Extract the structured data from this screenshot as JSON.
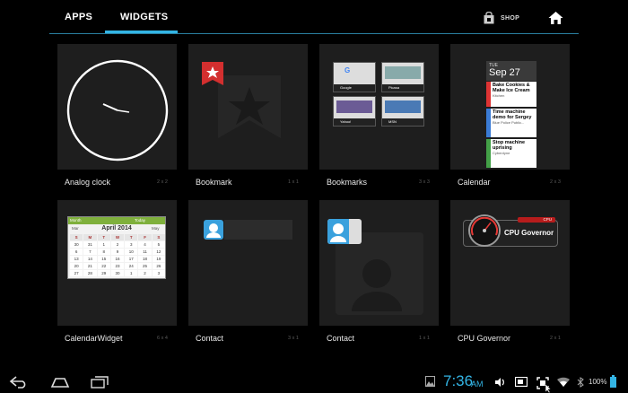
{
  "tabs": [
    {
      "label": "APPS"
    },
    {
      "label": "WIDGETS",
      "selected": true
    }
  ],
  "shop": {
    "label": "SHOP",
    "icon": "shopping-bag-icon"
  },
  "home": {
    "icon": "home-icon"
  },
  "widgets": [
    {
      "name": "Analog clock",
      "size": "2 x 2"
    },
    {
      "name": "Bookmark",
      "size": "1 x 1"
    },
    {
      "name": "Bookmarks",
      "size": "3 x 3"
    },
    {
      "name": "Calendar",
      "size": "2 x 3"
    },
    {
      "name": "CalendarWidget",
      "size": "6 x 4"
    },
    {
      "name": "Contact",
      "size": "3 x 1"
    },
    {
      "name": "Contact",
      "size": "1 x 1"
    },
    {
      "name": "CPU Governor",
      "size": "2 x 1"
    }
  ],
  "bookmarks_preview": [
    {
      "label": "Google"
    },
    {
      "label": "Picasa"
    },
    {
      "label": "Yahoo!"
    },
    {
      "label": "MSN"
    }
  ],
  "calendar_preview": {
    "day": "TUE",
    "date": "Sep 27",
    "events": [
      {
        "title": "Bake Cookies & Make Ice Cream",
        "sub": "Kitchen"
      },
      {
        "title": "Time machine demo for Sergey",
        "sub": "Blue Police Public..."
      },
      {
        "title": "Stop machine uprising",
        "sub": "Cyberdyne"
      }
    ]
  },
  "calendar_widget_preview": {
    "month_label": "Month",
    "today_label": "Today",
    "prev": "Mar",
    "title": "April 2014",
    "next": "May",
    "weekdays": [
      "S",
      "M",
      "T",
      "W",
      "T",
      "F",
      "S"
    ],
    "days": [
      "30",
      "31",
      "1",
      "2",
      "3",
      "4",
      "5",
      "6",
      "7",
      "8",
      "9",
      "10",
      "11",
      "12",
      "13",
      "14",
      "15",
      "16",
      "17",
      "18",
      "19",
      "20",
      "21",
      "22",
      "23",
      "24",
      "25",
      "26",
      "27",
      "28",
      "29",
      "30",
      "1",
      "2",
      "3"
    ]
  },
  "cpu_preview": {
    "tag": "CPU",
    "label": "CPU Governor"
  },
  "statusbar": {
    "time": "7:36",
    "ampm": "AM",
    "battery": "100%"
  },
  "colors": {
    "accent": "#33b5e5",
    "card_bg": "#1e1e1e",
    "background": "#000000"
  }
}
